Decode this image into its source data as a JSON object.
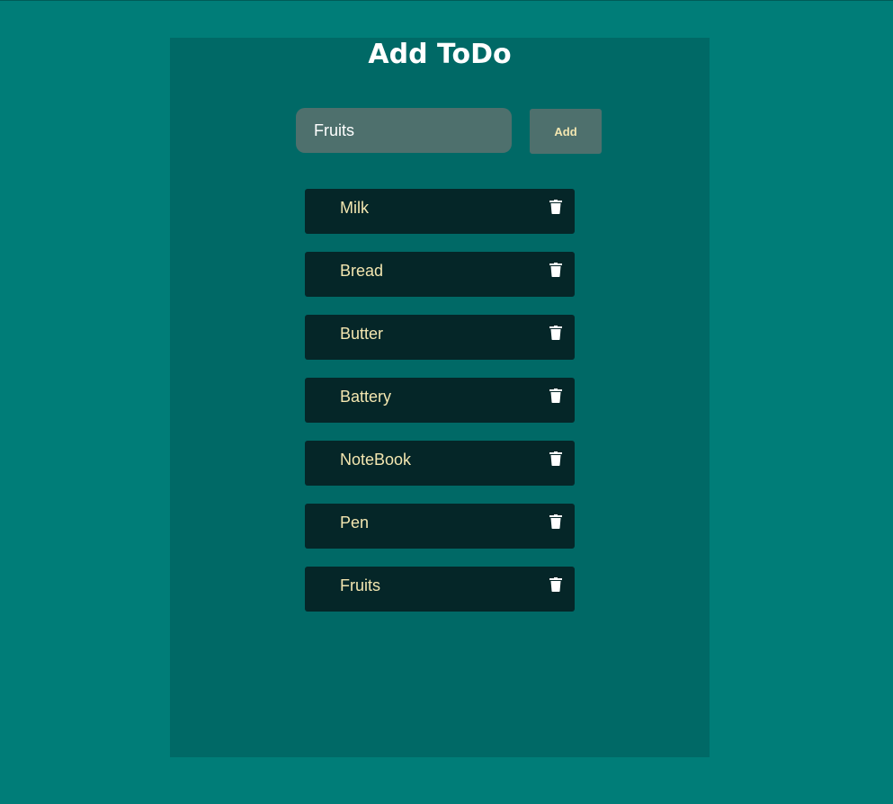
{
  "header": {
    "title": "Add ToDo"
  },
  "form": {
    "input_value": "Fruits",
    "add_label": "Add"
  },
  "todos": [
    {
      "text": "Milk"
    },
    {
      "text": "Bread"
    },
    {
      "text": "Butter"
    },
    {
      "text": "Battery"
    },
    {
      "text": "NoteBook"
    },
    {
      "text": "Pen"
    },
    {
      "text": "Fruits"
    }
  ],
  "icons": {
    "delete": "trash-icon"
  },
  "colors": {
    "page_background": "#007d78",
    "panel_background": "#006966",
    "input_background": "#4e706d",
    "item_background": "#052628",
    "item_text": "#f3e6b0",
    "title_text": "#ffffff"
  }
}
